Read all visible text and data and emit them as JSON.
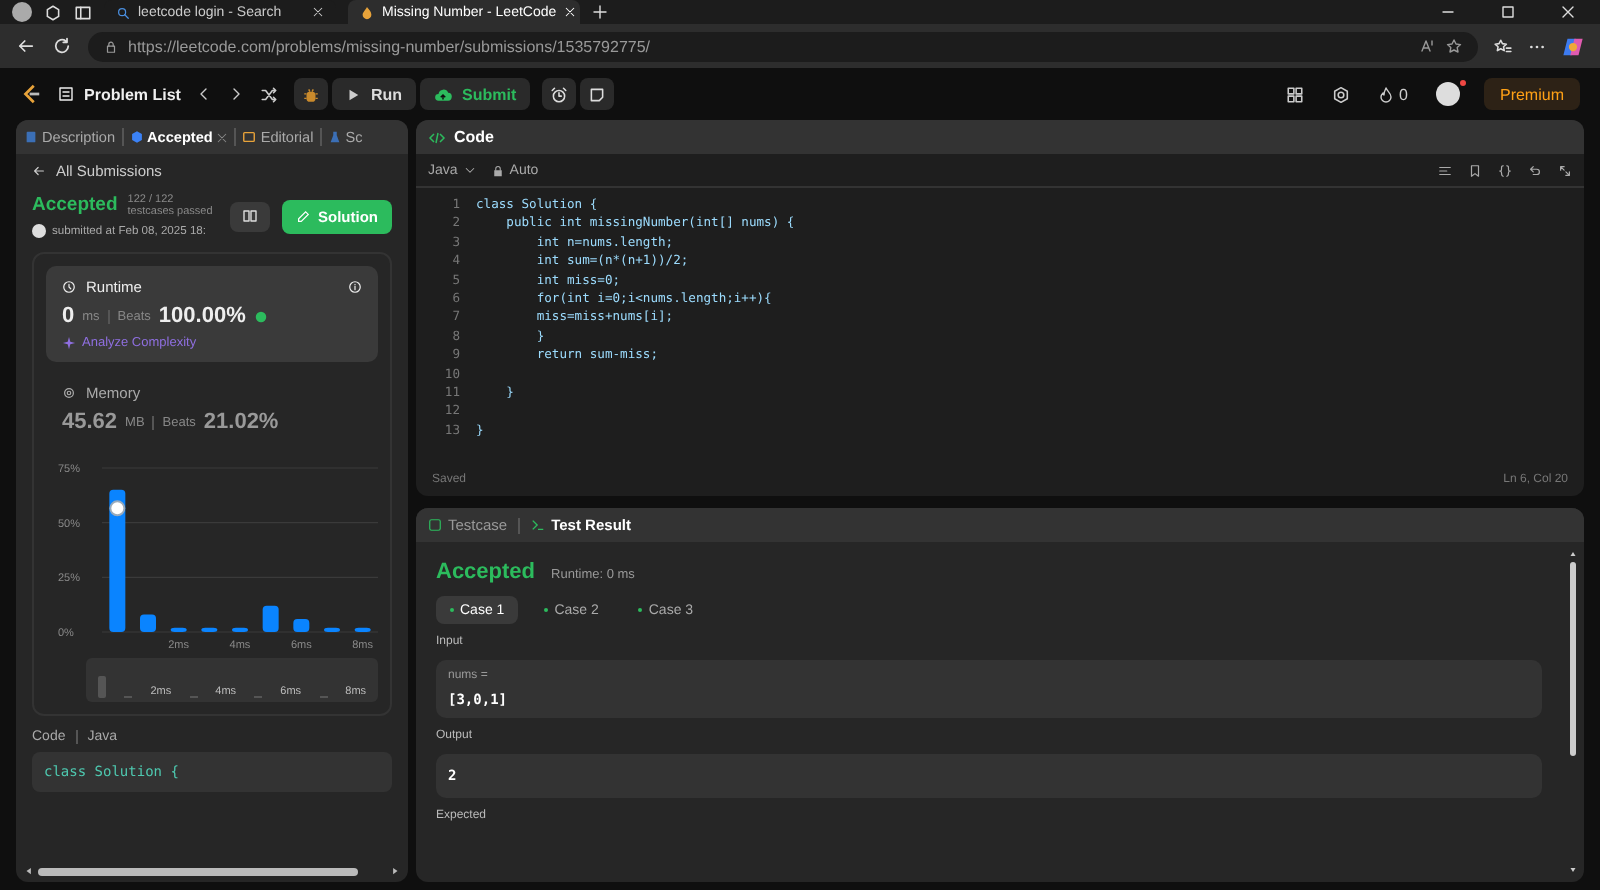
{
  "browser": {
    "tabs": [
      {
        "title": "leetcode login - Search",
        "selected": false
      },
      {
        "title": "Missing Number - LeetCode",
        "selected": true
      }
    ],
    "url": "https://leetcode.com/problems/missing-number/submissions/1535792775/"
  },
  "topbar": {
    "problem_list": "Problem List",
    "run": "Run",
    "submit": "Submit",
    "streak": "0",
    "premium": "Premium"
  },
  "left_tabs": [
    {
      "label": "Description",
      "selected": false,
      "closable": false
    },
    {
      "label": "Accepted",
      "selected": true,
      "closable": true
    },
    {
      "label": "Editorial",
      "selected": false,
      "closable": false
    },
    {
      "label": "Sc",
      "selected": false,
      "closable": false
    }
  ],
  "submission": {
    "back": "All Submissions",
    "status": "Accepted",
    "testcases": "122 / 122 testcases passed",
    "submitted": "submitted at Feb 08, 2025 18:",
    "solution_button": "Solution",
    "runtime": {
      "title": "Runtime",
      "value": "0",
      "unit": "ms",
      "beats_label": "Beats",
      "beats": "100.00%",
      "analyze": "Analyze Complexity",
      "selected": true
    },
    "memory": {
      "title": "Memory",
      "value": "45.62",
      "unit": "MB",
      "beats_label": "Beats",
      "beats": "21.02%",
      "selected": false
    },
    "chart_data": {
      "type": "bar",
      "x": [
        0,
        1,
        2,
        3,
        4,
        5,
        6,
        7,
        8
      ],
      "xlim": [
        -0.5,
        8.5
      ],
      "values": [
        65,
        8,
        2,
        2,
        2,
        12,
        6,
        2,
        2
      ],
      "ylim": [
        0,
        75
      ],
      "yticks": [
        {
          "value": 0,
          "label": "0%"
        },
        {
          "value": 25,
          "label": "25%"
        },
        {
          "value": 50,
          "label": "50%"
        },
        {
          "value": 75,
          "label": "75%"
        }
      ],
      "xticks": [
        {
          "value": 2,
          "label": "2ms"
        },
        {
          "value": 4,
          "label": "4ms"
        },
        {
          "value": 6,
          "label": "6ms"
        },
        {
          "value": 8,
          "label": "8ms"
        }
      ]
    },
    "navigator": {
      "labels": [
        "2ms",
        "4ms",
        "6ms",
        "8ms"
      ]
    },
    "code_label": "Code",
    "code_language": "Java",
    "code_preview": "class Solution {"
  },
  "editor": {
    "title": "Code",
    "language": "Java",
    "mode": "Auto",
    "lines": [
      {
        "n": "1",
        "text": "class Solution {"
      },
      {
        "n": "2",
        "text": "    public int missingNumber(int[] nums) {"
      },
      {
        "n": "3",
        "text": "        int n=nums.length;"
      },
      {
        "n": "4",
        "text": "        int sum=(n*(n+1))/2;"
      },
      {
        "n": "5",
        "text": "        int miss=0;"
      },
      {
        "n": "6",
        "text": "        for(int i=0;i<nums.length;i++){"
      },
      {
        "n": "7",
        "text": "        miss=miss+nums[i];"
      },
      {
        "n": "8",
        "text": "        }"
      },
      {
        "n": "9",
        "text": "        return sum-miss;"
      },
      {
        "n": "10"
      },
      {
        "n": "11",
        "text": "    }"
      },
      {
        "n": "12"
      },
      {
        "n": "13",
        "text": "}"
      }
    ],
    "status": "Saved",
    "cursor": "Ln 6, Col 20"
  },
  "result": {
    "tabs": [
      {
        "label": "Testcase",
        "selected": false
      },
      {
        "label": "Test Result",
        "selected": true
      }
    ],
    "status": "Accepted",
    "runtime": "Runtime: 0 ms",
    "cases": [
      {
        "label": "Case 1",
        "selected": true
      },
      {
        "label": "Case 2",
        "selected": false
      },
      {
        "label": "Case 3",
        "selected": false
      }
    ],
    "input_label": "Input",
    "param": "nums =",
    "input_value": "[3,0,1]",
    "output_label": "Output",
    "output_value": "2",
    "expected_label": "Expected"
  }
}
